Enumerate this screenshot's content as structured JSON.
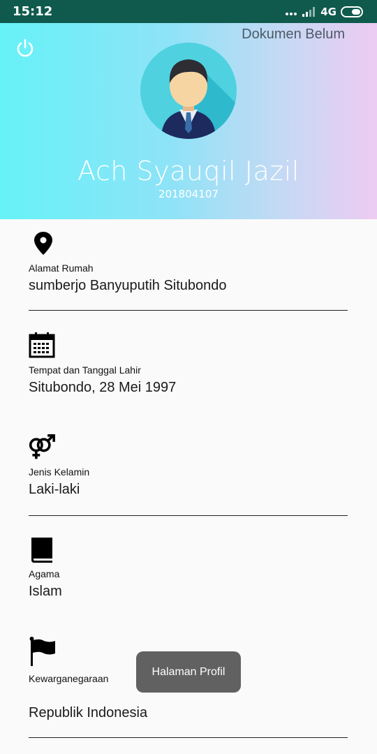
{
  "status_bar": {
    "time": "15:12",
    "network": "4G"
  },
  "header": {
    "document_status": "Dokumen Belum",
    "name": "Ach Syauqil Jazil",
    "student_id": "201804107"
  },
  "fields": [
    {
      "icon": "location-pin-icon",
      "label": "Alamat Rumah",
      "value": "sumberjo Banyuputih Situbondo"
    },
    {
      "icon": "calendar-icon",
      "label": "Tempat dan Tanggal Lahir",
      "value": "Situbondo, 28 Mei 1997"
    },
    {
      "icon": "gender-icon",
      "label": "Jenis Kelamin",
      "value": "Laki-laki"
    },
    {
      "icon": "book-icon",
      "label": "Agama",
      "value": "Islam"
    },
    {
      "icon": "flag-icon",
      "label": "Kewarganegaraan",
      "value": "Republik Indonesia"
    }
  ],
  "toast": "Halaman Profil"
}
